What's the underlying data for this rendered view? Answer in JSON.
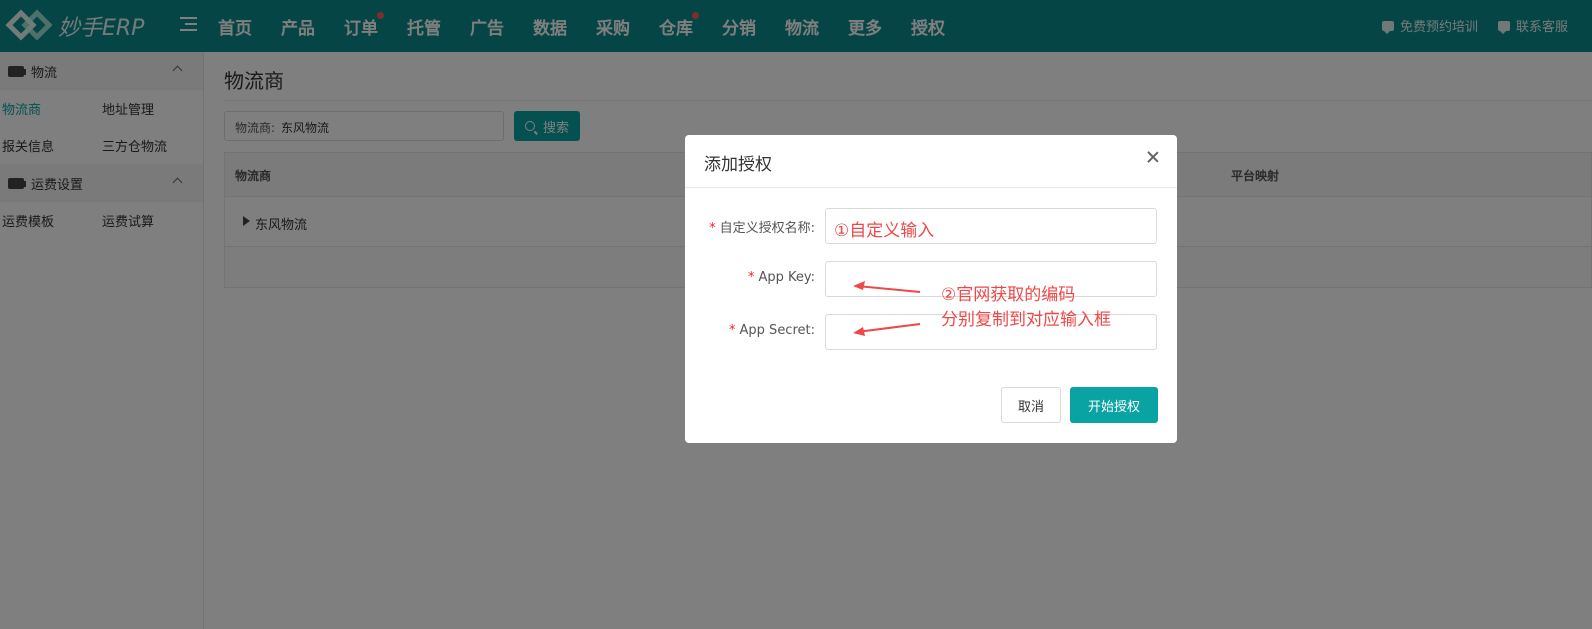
{
  "app": {
    "logo_text": "妙手ERP"
  },
  "nav": {
    "items": [
      {
        "label": "首页",
        "dot": false
      },
      {
        "label": "产品",
        "dot": false
      },
      {
        "label": "订单",
        "dot": true
      },
      {
        "label": "托管",
        "dot": false
      },
      {
        "label": "广告",
        "dot": false
      },
      {
        "label": "数据",
        "dot": false
      },
      {
        "label": "采购",
        "dot": false
      },
      {
        "label": "仓库",
        "dot": true
      },
      {
        "label": "分销",
        "dot": false
      },
      {
        "label": "物流",
        "dot": false
      },
      {
        "label": "更多",
        "dot": false
      },
      {
        "label": "授权",
        "dot": false
      }
    ],
    "right": {
      "training": "免费预约培训",
      "support": "联系客服"
    }
  },
  "sidebar": {
    "groups": [
      {
        "title": "物流",
        "items": [
          "物流商",
          "地址管理",
          "报关信息",
          "三方仓物流"
        ],
        "active": "物流商"
      },
      {
        "title": "运费设置",
        "items": [
          "运费模板",
          "运费试算"
        ]
      }
    ]
  },
  "page": {
    "title": "物流商",
    "filter": {
      "label": "物流商:",
      "value": "东风物流"
    },
    "search_label": "搜索",
    "table": {
      "headers": [
        "物流商",
        "平台映射"
      ],
      "rows": [
        "东风物流"
      ]
    }
  },
  "modal": {
    "title": "添加授权",
    "fields": [
      {
        "label": "自定义授权名称:",
        "value": "①自定义输入"
      },
      {
        "label": "App Key:",
        "value": ""
      },
      {
        "label": "App Secret:",
        "value": ""
      }
    ],
    "annotation": [
      "②官网获取的编码",
      "分别复制到对应输入框"
    ],
    "cancel_label": "取消",
    "ok_label": "开始授权"
  },
  "colors": {
    "accent": "#0aa3a3",
    "topbar": "#0a8a8a",
    "annotation": "#f04848"
  }
}
